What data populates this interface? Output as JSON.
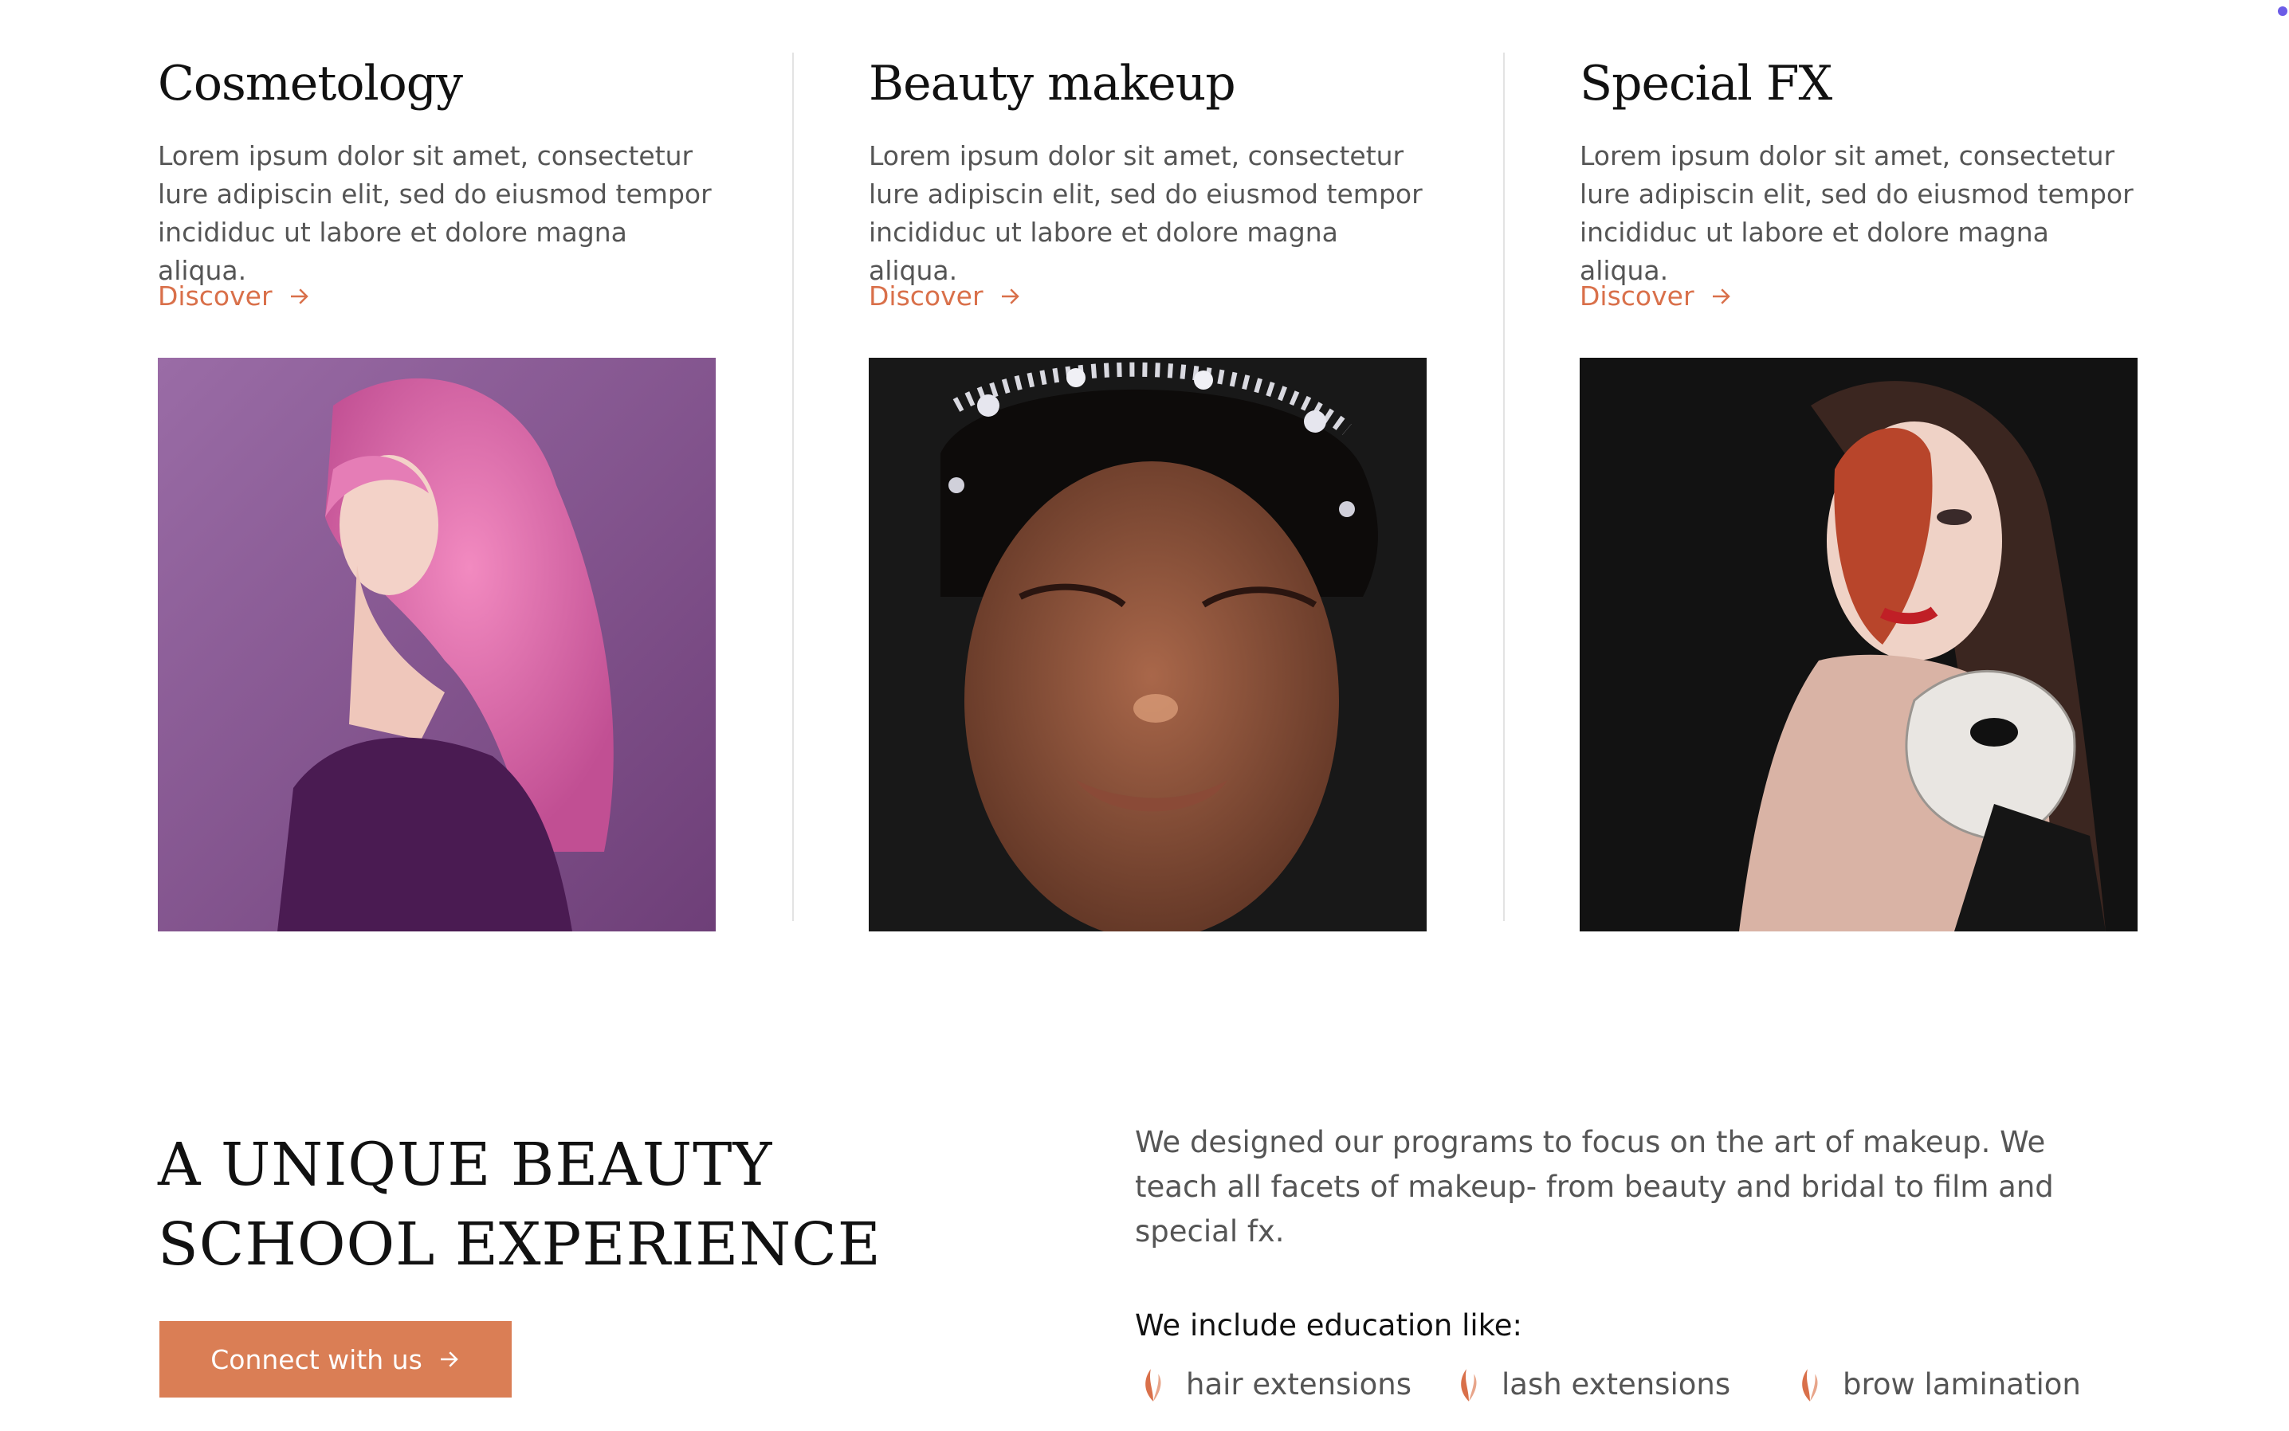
{
  "columns": [
    {
      "title": "Cosmetology",
      "body": "Lorem ipsum dolor sit amet, consectetur lure adipiscin elit, sed do eiusmod tempor incididuc ut labore et dolore magna aliqua.",
      "link": "Discover",
      "image": "woman with pink wavy hair, purple background"
    },
    {
      "title": "Beauty makeup",
      "body": "Lorem ipsum dolor sit amet, consectetur lure adipiscin elit, sed do eiusmod tempor incididuc ut labore et dolore magna aliqua.",
      "link": "Discover",
      "image": "woman with jeweled headpiece, dark background"
    },
    {
      "title": "Special FX",
      "body": "Lorem ipsum dolor sit amet, consectetur lure adipiscin elit, sed do eiusmod tempor incididuc ut labore et dolore magna aliqua.",
      "link": "Discover",
      "image": "woman with burn effect makeup holding mask"
    }
  ],
  "school": {
    "heading": "A UNIQUE BEAUTY SCHOOL EXPERIENCE",
    "cta": "Connect with us",
    "intro": "We designed our programs to focus on the art of makeup. We teach all facets of makeup- from beauty and bridal to film and special fx.",
    "education_label": "We include education like:",
    "education_items": [
      "hair extensions",
      "lash extensions",
      "brow lamination"
    ]
  },
  "colors": {
    "accent": "#d9704a",
    "button": "#da7e55",
    "text": "#555555",
    "heading": "#111111"
  }
}
